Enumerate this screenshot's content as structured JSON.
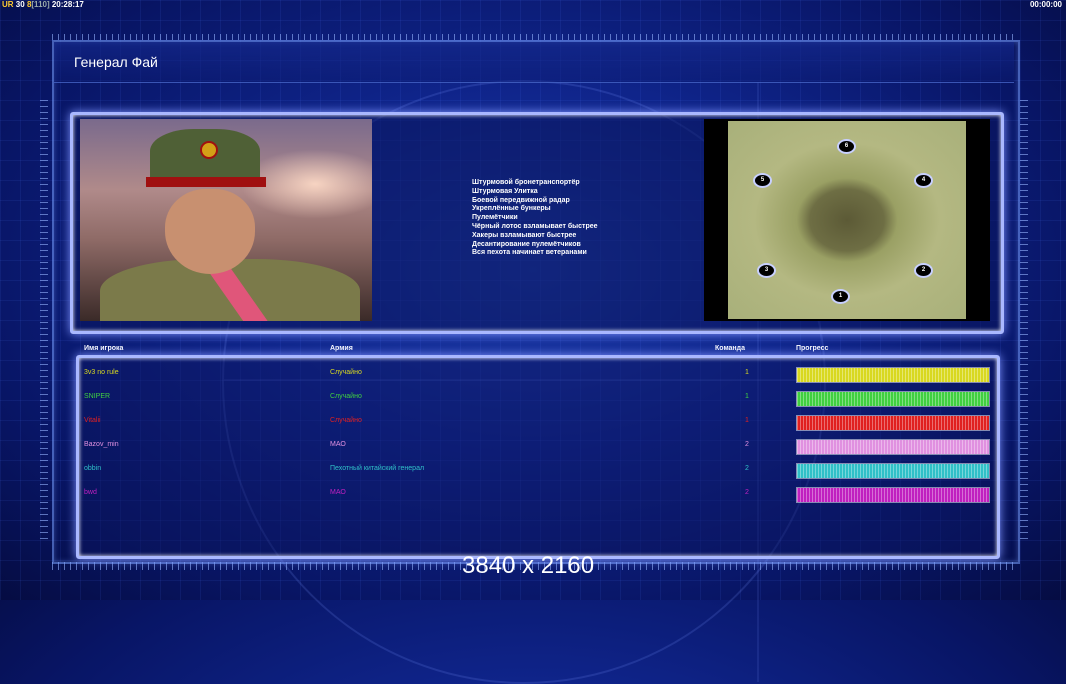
{
  "hud": {
    "left_prefix": "UR",
    "left_a": "30",
    "left_b": "8",
    "left_c": "[110]",
    "left_time": "20:28:17",
    "right_time": "00:00:00"
  },
  "general": {
    "name": "Генерал Фай",
    "perks": [
      "Штурмовой бронетранспортёр",
      "Штурмовая Улитка",
      "Боевой передвижной радар",
      "Укреплённые бункеры",
      "Пулемётчики",
      "Чёрный лотос взламывает быстрее",
      "Хакеры взламывают быстрее",
      "Десантирование пулемётчиков",
      "Вся пехота начинает ветеранами"
    ]
  },
  "minimap": {
    "spawns": [
      "6",
      "5",
      "4",
      "3",
      "2",
      "1"
    ]
  },
  "table": {
    "headers": {
      "player": "Имя игрока",
      "army": "Армия",
      "team": "Команда",
      "progress": "Прогресс"
    },
    "rows": [
      {
        "name": "3v3 no rule",
        "army": "Случайно",
        "team": "1",
        "color": "#d8d820",
        "progress": 1.0
      },
      {
        "name": "SNIPER",
        "army": "Случайно",
        "team": "1",
        "color": "#40d040",
        "progress": 1.0
      },
      {
        "name": "Vitalii",
        "army": "Случайно",
        "team": "1",
        "color": "#e02020",
        "progress": 1.0
      },
      {
        "name": "Bazov_min",
        "army": "МАО",
        "team": "2",
        "color": "#e090e0",
        "progress": 1.0
      },
      {
        "name": "obbin",
        "army": "Пехотный китайский генерал",
        "team": "2",
        "color": "#30c0c8",
        "progress": 1.0
      },
      {
        "name": "bwd",
        "army": "МАО",
        "team": "2",
        "color": "#c020c0",
        "progress": 1.0
      }
    ]
  },
  "watermark": "3840 x 2160"
}
